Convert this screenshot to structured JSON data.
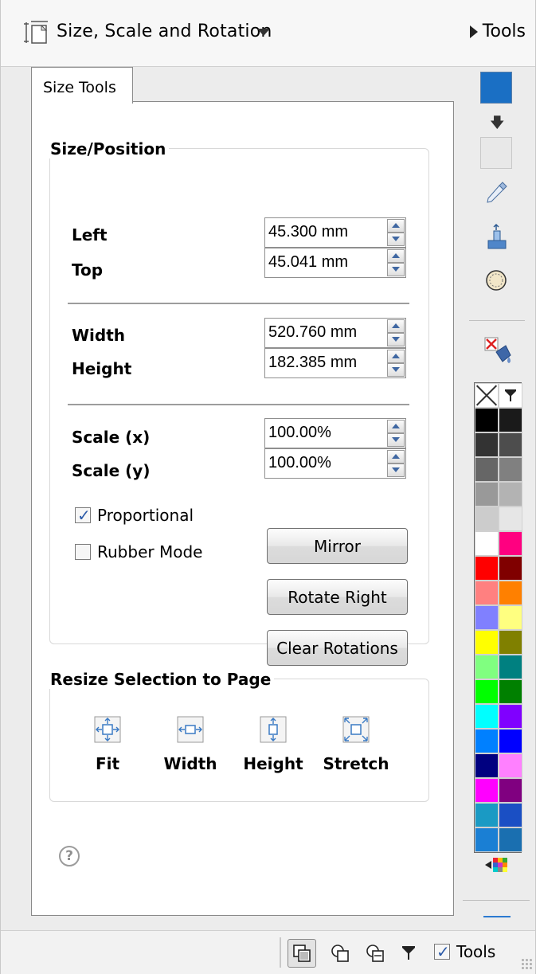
{
  "header": {
    "title": "Size, Scale and Rotation",
    "tools_label": "Tools"
  },
  "tab": {
    "label": "Size Tools"
  },
  "size_position": {
    "legend": "Size/Position",
    "left": {
      "label": "Left",
      "value": "45.300 mm"
    },
    "top": {
      "label": "Top",
      "value": "45.041 mm"
    },
    "width": {
      "label": "Width",
      "value": "520.760 mm"
    },
    "height": {
      "label": "Height",
      "value": "182.385 mm"
    },
    "scale_x": {
      "label": "Scale (x)",
      "value": "100.00%"
    },
    "scale_y": {
      "label": "Scale (y)",
      "value": "100.00%"
    },
    "proportional": {
      "label": "Proportional",
      "checked": true
    },
    "rubber_mode": {
      "label": "Rubber Mode",
      "checked": false
    },
    "mirror_label": "Mirror",
    "rotate_right_label": "Rotate Right",
    "clear_rotations_label": "Clear Rotations"
  },
  "resize": {
    "legend": "Resize Selection to Page",
    "fit_label": "Fit",
    "width_label": "Width",
    "height_label": "Height",
    "stretch_label": "Stretch"
  },
  "help_glyph": "?",
  "tool_strip": {
    "fill_color": "#1a6fc4",
    "stroke_color": "#e8e8e8",
    "palette": [
      "#000000",
      "#1a1a1a",
      "#333333",
      "#4d4d4d",
      "#666666",
      "#808080",
      "#999999",
      "#b3b3b3",
      "#cccccc",
      "#e6e6e6",
      "#ffffff",
      "#ff0080",
      "#ff0000",
      "#800000",
      "#ff8080",
      "#ff8000",
      "#8080ff",
      "#ffff80",
      "#ffff00",
      "#808000",
      "#80ff80",
      "#008080",
      "#00ff00",
      "#008000",
      "#00ffff",
      "#8000ff",
      "#0080ff",
      "#0000ff",
      "#000080",
      "#ff80ff",
      "#ff00ff",
      "#800080",
      "#1a9ac4",
      "#1a4fc4",
      "#1a7fd4",
      "#1a6fb0"
    ]
  },
  "statusbar": {
    "tools_label": "Tools",
    "tools_checked": true
  }
}
